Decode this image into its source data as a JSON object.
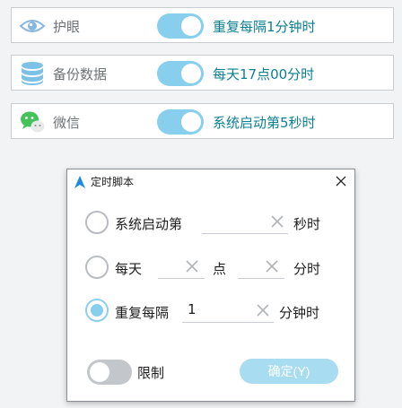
{
  "tasks": [
    {
      "name": "护眼",
      "schedule": "重复每隔1分钟时",
      "icon": "eye-icon",
      "enabled": true
    },
    {
      "name": "备份数据",
      "schedule": "每天17点00分时",
      "icon": "database-icon",
      "enabled": true
    },
    {
      "name": "微信",
      "schedule": "系统启动第5秒时",
      "icon": "wechat-icon",
      "enabled": true
    }
  ],
  "dialog": {
    "title": "定时脚本",
    "options": {
      "startup": {
        "label": "系统启动第",
        "value": "",
        "unit": "秒时"
      },
      "daily": {
        "label": "每天",
        "hour_value": "",
        "hour_unit": "点",
        "minute_value": "",
        "minute_unit": "分时"
      },
      "repeat": {
        "label": "重复每隔",
        "value": "1",
        "unit": "分钟时"
      }
    },
    "selected": "repeat",
    "limit_label": "限制",
    "limit_enabled": false,
    "confirm_label": "确定(Y)"
  },
  "colors": {
    "accent": "#87cfec",
    "schedule_text": "#0a7f92",
    "confirm_bg": "#a7dcf1"
  }
}
